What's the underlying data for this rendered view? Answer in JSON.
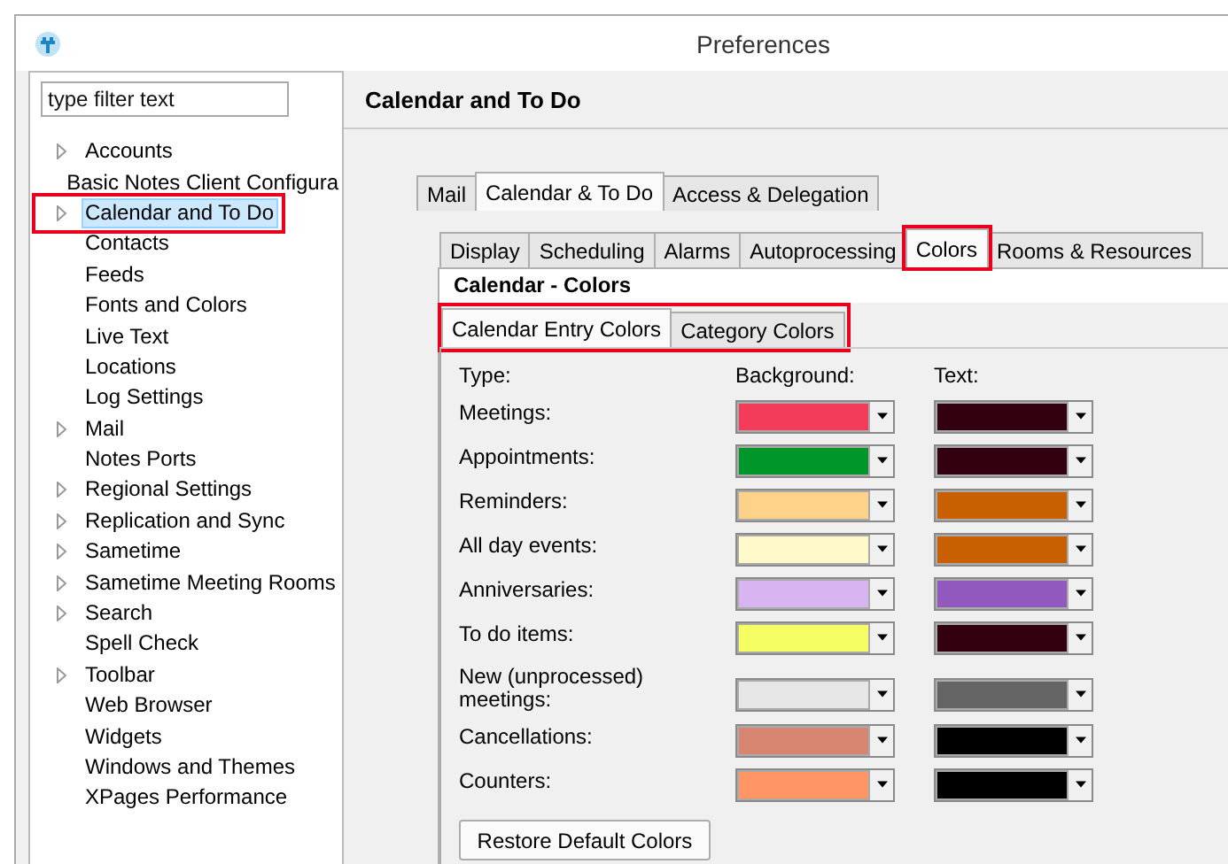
{
  "window": {
    "title": "Preferences"
  },
  "filter": {
    "placeholder": "type filter text"
  },
  "tree": [
    {
      "label": "Accounts",
      "expandable": true,
      "selected": false,
      "highlighted": false
    },
    {
      "label": "Basic Notes Client Configura",
      "expandable": false,
      "selected": false,
      "highlighted": false
    },
    {
      "label": "Calendar and To Do",
      "expandable": true,
      "selected": true,
      "highlighted": true
    },
    {
      "label": "Contacts",
      "expandable": false,
      "selected": false,
      "highlighted": false
    },
    {
      "label": "Feeds",
      "expandable": false,
      "selected": false,
      "highlighted": false
    },
    {
      "label": "Fonts and Colors",
      "expandable": false,
      "selected": false,
      "highlighted": false
    },
    {
      "label": "Live Text",
      "expandable": false,
      "selected": false,
      "highlighted": false
    },
    {
      "label": "Locations",
      "expandable": false,
      "selected": false,
      "highlighted": false
    },
    {
      "label": "Log Settings",
      "expandable": false,
      "selected": false,
      "highlighted": false
    },
    {
      "label": "Mail",
      "expandable": true,
      "selected": false,
      "highlighted": false
    },
    {
      "label": "Notes Ports",
      "expandable": false,
      "selected": false,
      "highlighted": false
    },
    {
      "label": "Regional Settings",
      "expandable": true,
      "selected": false,
      "highlighted": false
    },
    {
      "label": "Replication and Sync",
      "expandable": true,
      "selected": false,
      "highlighted": false
    },
    {
      "label": "Sametime",
      "expandable": true,
      "selected": false,
      "highlighted": false
    },
    {
      "label": "Sametime Meeting Rooms",
      "expandable": true,
      "selected": false,
      "highlighted": false
    },
    {
      "label": "Search",
      "expandable": true,
      "selected": false,
      "highlighted": false
    },
    {
      "label": "Spell Check",
      "expandable": false,
      "selected": false,
      "highlighted": false
    },
    {
      "label": "Toolbar",
      "expandable": true,
      "selected": false,
      "highlighted": false
    },
    {
      "label": "Web Browser",
      "expandable": false,
      "selected": false,
      "highlighted": false
    },
    {
      "label": "Widgets",
      "expandable": false,
      "selected": false,
      "highlighted": false
    },
    {
      "label": "Windows and Themes",
      "expandable": false,
      "selected": false,
      "highlighted": false
    },
    {
      "label": "XPages Performance",
      "expandable": false,
      "selected": false,
      "highlighted": false
    }
  ],
  "page_title": "Calendar and To Do",
  "tabs": [
    {
      "label": "Mail",
      "selected": false,
      "highlighted": false
    },
    {
      "label": "Calendar & To Do",
      "selected": true,
      "highlighted": false
    },
    {
      "label": "Access & Delegation",
      "selected": false,
      "highlighted": false
    }
  ],
  "subtabs": [
    {
      "label": "Display",
      "selected": false,
      "highlighted": false
    },
    {
      "label": "Scheduling",
      "selected": false,
      "highlighted": false
    },
    {
      "label": "Alarms",
      "selected": false,
      "highlighted": false
    },
    {
      "label": "Autoprocessing",
      "selected": false,
      "highlighted": false
    },
    {
      "label": "Colors",
      "selected": true,
      "highlighted": true
    },
    {
      "label": "Rooms & Resources",
      "selected": false,
      "highlighted": false
    }
  ],
  "section_title": "Calendar - Colors",
  "inner_tabs": {
    "highlighted": true,
    "items": [
      {
        "label": "Calendar Entry Colors",
        "selected": true
      },
      {
        "label": "Category Colors",
        "selected": false
      }
    ]
  },
  "columns": [
    "Type:",
    "Background:",
    "Text:"
  ],
  "rows": [
    {
      "label": "Meetings:",
      "background": {
        "color": "#f23c5a"
      },
      "text": {
        "color": "#33000f"
      }
    },
    {
      "label": "Appointments:",
      "background": {
        "color": "#00962a"
      },
      "text": {
        "color": "#33000f"
      }
    },
    {
      "label": "Reminders:",
      "background": {
        "color": "#ffd28a"
      },
      "text": {
        "color": "#c85f00"
      }
    },
    {
      "label": "All day events:",
      "background": {
        "color": "#fff8c8"
      },
      "text": {
        "color": "#c85f00"
      }
    },
    {
      "label": "Anniversaries:",
      "background": {
        "color": "#d8b4f0"
      },
      "text": {
        "color": "#9158be"
      }
    },
    {
      "label": "To do items:",
      "background": {
        "color": "#f5ff64"
      },
      "text": {
        "color": "#33000f"
      }
    },
    {
      "label": "New (unprocessed) meetings:",
      "background": {
        "color": "#e6e6e6"
      },
      "text": {
        "color": "#646464"
      }
    },
    {
      "label": "Cancellations:",
      "background": {
        "color": "#d78470"
      },
      "text": {
        "color": "#000000"
      }
    },
    {
      "label": "Counters:",
      "background": {
        "color": "#ff9664"
      },
      "text": {
        "color": "#000000"
      }
    }
  ],
  "restore_button": "Restore Default Colors"
}
